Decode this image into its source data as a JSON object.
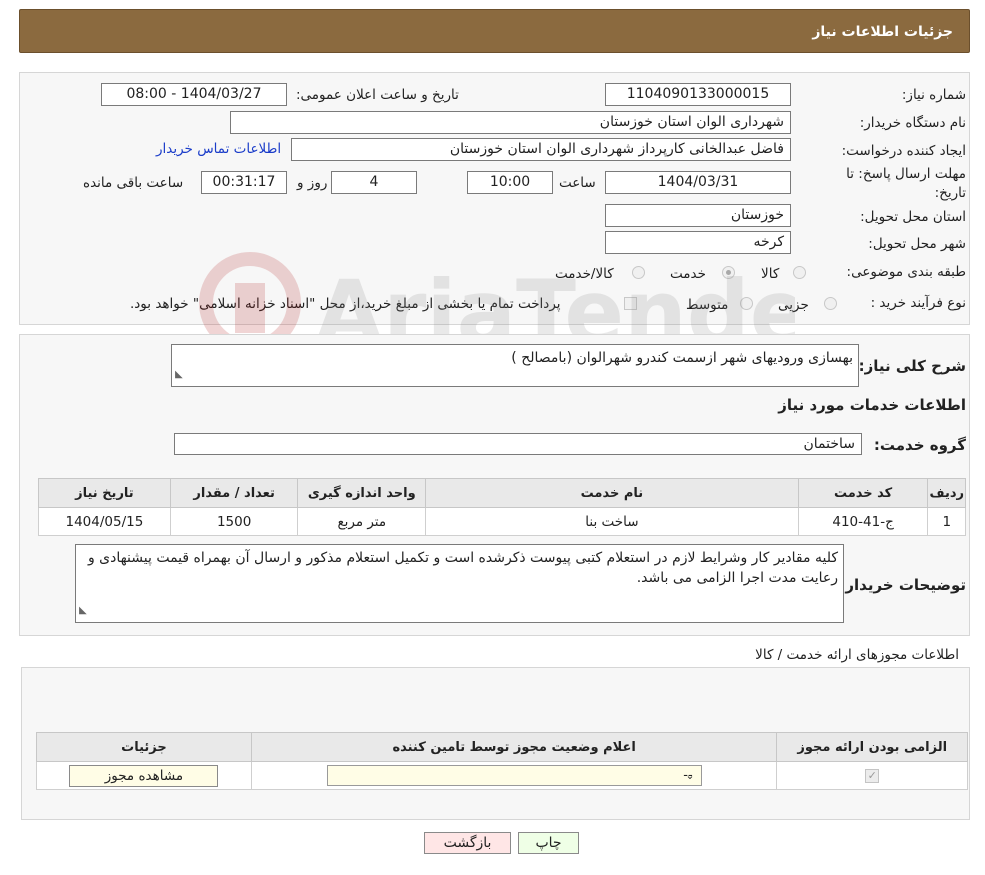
{
  "header": {
    "title": "جزئیات اطلاعات نیاز"
  },
  "need": {
    "need_number_label": "شماره نیاز:",
    "need_number": "1104090133000015",
    "announce_label": "تاریخ و ساعت اعلان عمومی:",
    "announce_value": "1404/03/27 - 08:00",
    "buyer_org_label": "نام دستگاه خریدار:",
    "buyer_org": "شهرداری الوان استان خوزستان",
    "creator_label": "ایجاد کننده درخواست:",
    "creator": "فاضل  عبدالخانی کارپرداز شهرداری الوان استان خوزستان",
    "contact_link": "اطلاعات تماس خریدار",
    "deadline_label": "مهلت ارسال پاسخ: تا تاریخ:",
    "deadline_date": "1404/03/31",
    "hour_label": "ساعت",
    "deadline_hour": "10:00",
    "days": "4",
    "days_label": "روز و",
    "remaining": "00:31:17",
    "remaining_label": "ساعت باقی مانده",
    "province_label": "استان محل تحویل:",
    "province": "خوزستان",
    "city_label": "شهر محل تحویل:",
    "city": "کرخه",
    "category_label": "طبقه بندی موضوعی:",
    "category_options": [
      "کالا",
      "خدمت",
      "کالا/خدمت"
    ],
    "category_selected": "خدمت",
    "process_label": "نوع فرآیند خرید :",
    "process_options": [
      "جزیی",
      "متوسط"
    ],
    "process_note": "پرداخت تمام یا بخشی از مبلغ خرید،از محل \"اسناد خزانه اسلامی\" خواهد بود."
  },
  "desc": {
    "summary_label": "شرح کلی نیاز:",
    "summary": "بهسازی ورودیهای شهر ازسمت کندرو شهرالوان (بامصالح )",
    "services_heading": "اطلاعات خدمات مورد نیاز",
    "group_label": "گروه خدمت:",
    "group": "ساختمان",
    "table": {
      "headers": [
        "ردیف",
        "کد خدمت",
        "نام خدمت",
        "واحد اندازه گیری",
        "تعداد / مقدار",
        "تاریخ نیاز"
      ],
      "rows": [
        [
          "1",
          "ج-41-410",
          "ساخت بنا",
          "متر مربع",
          "1500",
          "1404/05/15"
        ]
      ]
    },
    "buyer_notes_label": "توضیحات خریدار:",
    "buyer_notes": "کلیه مقادیر کار وشرایط لازم  در استعلام کتبی پیوست ذکرشده است و تکمیل استعلام مذکور و ارسال آن بهمراه قیمت پیشنهادی و رعایت مدت اجرا  الزامی می باشد."
  },
  "permits": {
    "heading": "اطلاعات مجوزهای ارائه خدمت / کالا",
    "headers": [
      "الزامی بودن ارائه مجوز",
      "اعلام وضعیت مجوز توسط تامین کننده",
      "جزئیات"
    ],
    "select_value": "--",
    "view_button": "مشاهده مجوز"
  },
  "footer": {
    "print_button": "چاپ",
    "back_button": "بازگشت"
  },
  "watermark": {
    "text": "AriaTender.neT"
  }
}
